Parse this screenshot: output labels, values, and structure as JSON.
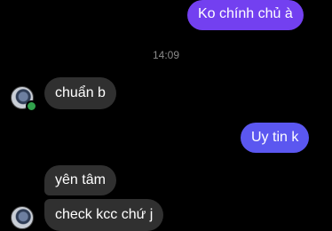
{
  "messages": [
    {
      "text": "Ko chính chủ à",
      "direction": "outgoing"
    },
    {
      "text": "chuẩn b",
      "direction": "incoming"
    },
    {
      "text": "Uy tin k",
      "direction": "outgoing"
    },
    {
      "text": "yên tâm",
      "direction": "incoming"
    },
    {
      "text": "check kcc chứ j",
      "direction": "incoming"
    }
  ],
  "timestamp": "14:09",
  "colors": {
    "background": "#000000",
    "outgoing_bubble": "#7340f0",
    "incoming_bubble": "#303030",
    "online_indicator": "#31a24c"
  },
  "contact": {
    "avatar_icon": "user-avatar-icon",
    "online": true
  }
}
